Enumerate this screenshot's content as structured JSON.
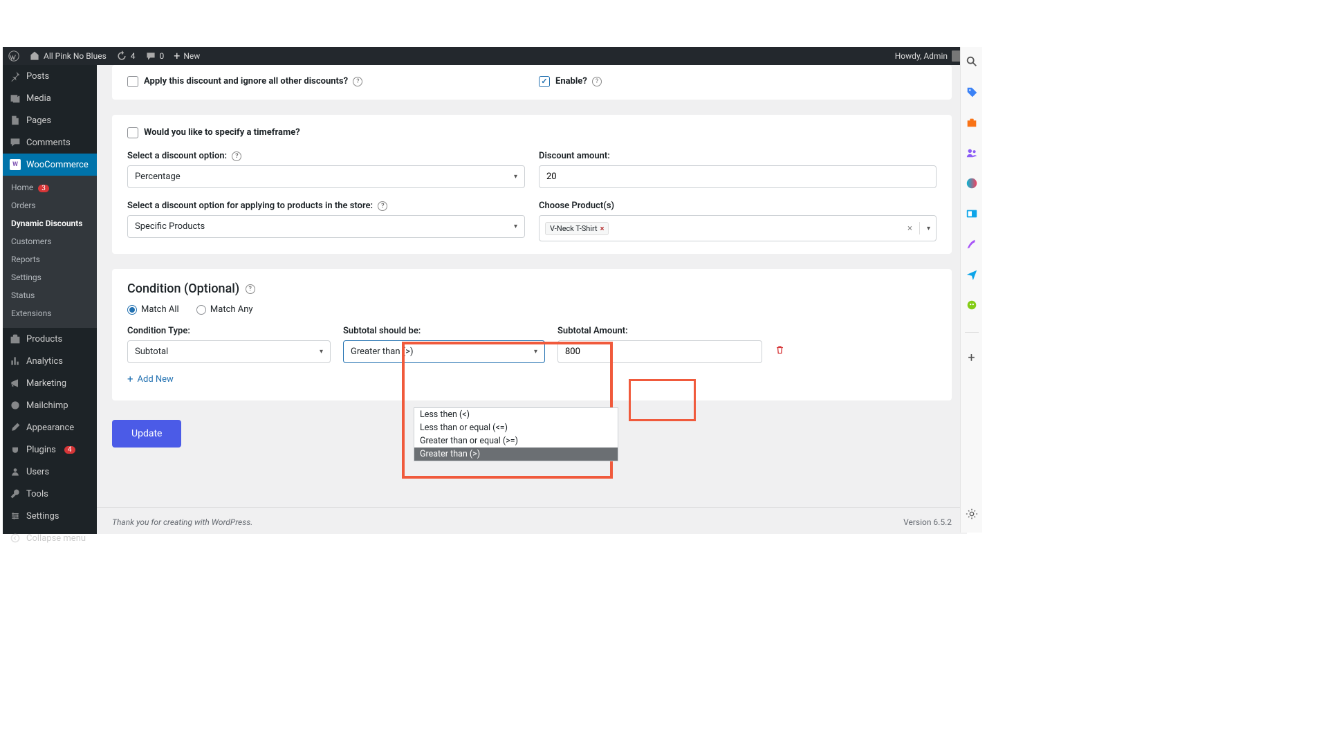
{
  "adminbar": {
    "site_name": "All Pink No Blues",
    "updates_count": "4",
    "comments_count": "0",
    "new_label": "New",
    "howdy": "Howdy, Admin"
  },
  "sidebar": {
    "posts": "Posts",
    "media": "Media",
    "pages": "Pages",
    "comments": "Comments",
    "woocommerce": "WooCommerce",
    "products": "Products",
    "analytics": "Analytics",
    "marketing": "Marketing",
    "mailchimp": "Mailchimp",
    "appearance": "Appearance",
    "plugins": "Plugins",
    "plugins_badge": "4",
    "users": "Users",
    "tools": "Tools",
    "settings": "Settings",
    "collapse": "Collapse menu",
    "woo_sub": {
      "home": "Home",
      "home_badge": "3",
      "orders": "Orders",
      "dynamic_discounts": "Dynamic Discounts",
      "customers": "Customers",
      "reports": "Reports",
      "settings": "Settings",
      "status": "Status",
      "extensions": "Extensions"
    }
  },
  "form": {
    "apply_ignore": "Apply this discount and ignore all other discounts?",
    "enable": "Enable?",
    "timeframe": "Would you like to specify a timeframe?",
    "discount_option_label": "Select a discount option:",
    "discount_option_value": "Percentage",
    "discount_amount_label": "Discount amount:",
    "discount_amount_value": "20",
    "apply_to_label": "Select a discount option for applying to products in the store:",
    "apply_to_value": "Specific Products",
    "choose_products_label": "Choose Product(s)",
    "product_chip": "V-Neck T-Shirt"
  },
  "condition": {
    "title": "Condition (Optional)",
    "match_all": "Match All",
    "match_any": "Match Any",
    "type_label": "Condition Type:",
    "type_value": "Subtotal",
    "subtotal_label": "Subtotal should be:",
    "subtotal_value": "Greater than (>)",
    "amount_label": "Subtotal Amount:",
    "amount_value": "800",
    "add_new": "Add New",
    "dropdown": {
      "opt1": "Less then (<)",
      "opt2": "Less than or equal (<=)",
      "opt3": "Greater than or equal (>=)",
      "opt4": "Greater than (>)"
    }
  },
  "update_btn": "Update",
  "footer": {
    "thanks": "Thank you for creating with WordPress.",
    "version": "Version 6.5.2"
  }
}
